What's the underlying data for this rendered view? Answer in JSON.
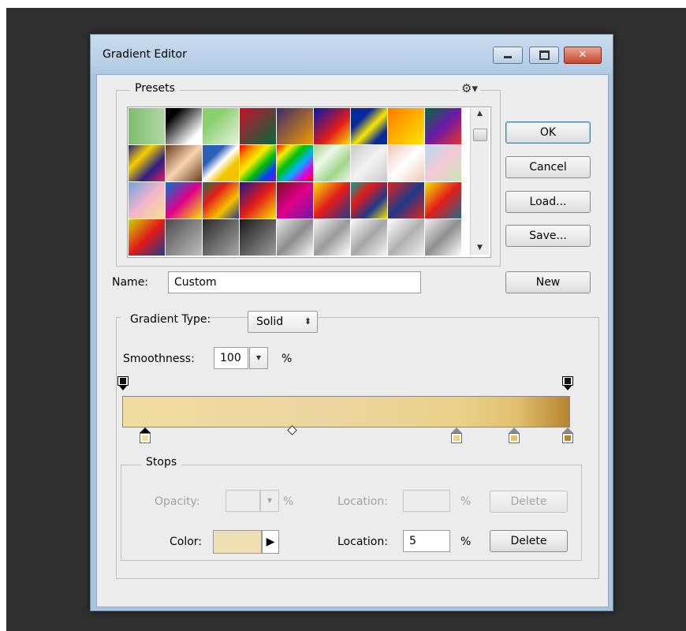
{
  "window": {
    "title": "Gradient Editor"
  },
  "presets": {
    "label": "Presets",
    "icon": "gear-icon",
    "swatches": [
      "linear-gradient(90deg,#7dbd6a,#b1d7a8)",
      "linear-gradient(135deg,#000 20%,#fff 80%)",
      "linear-gradient(135deg,#8bcf6f 30%,#e6f3e0 100%)",
      "linear-gradient(135deg,#c8102e,#006c3b)",
      "linear-gradient(135deg,#3b2a6e,#f59a00)",
      "linear-gradient(135deg,#0019a8,#e21b1b 60%,#f6e20a)",
      "linear-gradient(135deg,#0a2a9b 30%,#f8e600 55%,#0a2a9b 80%)",
      "linear-gradient(135deg,#ff7a00,#ffe600)",
      "linear-gradient(135deg,#006c3b,#6b1aa8,#e8332a)",
      "linear-gradient(135deg,#2c1f86,#f2d000,#2c1f86,#e51d5d)",
      "linear-gradient(135deg,#6b3b1f,#f8d4b0,#6b3b1f)",
      "linear-gradient(135deg,#2d5fb8 30%,#fff 50%,#f3c300 70%)",
      "linear-gradient(135deg,#ff0000,#ff8c00,#ffee00,#00c000,#0040ff,#a000c0)",
      "linear-gradient(135deg,#ff0000,#ffee00,#00c000,#00b0ff,#e000e0,#ff0000)",
      "linear-gradient(135deg,#a0d48a,#eef7e8,#a0d48a,#eef7e8)",
      "linear-gradient(135deg,#c8c8c8,#f2f2f2,#c8c8c8)",
      "linear-gradient(135deg,#f0c7b8,#fff,#f0c7b8)",
      "linear-gradient(135deg,#b9d8f0,#f2c9d6,#c7e6b0)",
      "linear-gradient(135deg,#6aa4e0,#f3b5c8,#f8e08e)",
      "linear-gradient(135deg,#0077c8,#e0008a,#f6e400)",
      "linear-gradient(135deg,#1f7a3a,#e21b1b,#f4c000,#1f3a8a)",
      "linear-gradient(135deg,#1a1a8c,#e21b1b,#f6e400)",
      "linear-gradient(135deg,#7a0f1f,#e0008a,#6b1aa8)",
      "linear-gradient(135deg,#f6e400,#e21b1b,#1f3a8a)",
      "linear-gradient(135deg,#00a896,#e21b1b,#1f3a8a,#f6e400)",
      "linear-gradient(135deg,#e2231a,#1f3a8a,#e2231a)",
      "linear-gradient(135deg,#f6e400,#e21b1b,#1f6a8a)",
      "linear-gradient(135deg,#c8d800,#e21b1b,#1f3a8a)",
      "linear-gradient(135deg,#4d4d4d,#bdbdbd)",
      "linear-gradient(135deg,#2a2a2a,#a8a8a8)",
      "linear-gradient(135deg,#1a1a1a,#9c9c9c)",
      "linear-gradient(135deg,#e6e6e6,#8c8c8c,#f7f7f7)",
      "linear-gradient(135deg,#f2f2f2,#9a9a9a,#ffffff)",
      "linear-gradient(135deg,#fafafa,#a6a6a6,#f5f5f5)",
      "linear-gradient(135deg,#ffffff,#b0b0b0,#eeeeee)",
      "linear-gradient(135deg,#f0f0f0,#8e8e8e,#fdfdfd)"
    ]
  },
  "buttons": {
    "ok": "OK",
    "cancel": "Cancel",
    "load": "Load...",
    "save": "Save...",
    "new": "New",
    "delete_opacity": "Delete",
    "delete_color": "Delete"
  },
  "name_field": {
    "label": "Name:",
    "value": "Custom"
  },
  "gradient_type": {
    "label": "Gradient Type:",
    "value": "Solid"
  },
  "smoothness": {
    "label": "Smoothness:",
    "value": "100",
    "unit": "%"
  },
  "gradient": {
    "opacity_stops": [
      0,
      100
    ],
    "color_stops": [
      {
        "location": 5,
        "color": "#f0dba0",
        "selected": true
      },
      {
        "location": 75,
        "color": "#ead28a",
        "selected": false
      },
      {
        "location": 88,
        "color": "#e2c070",
        "selected": false
      },
      {
        "location": 100,
        "color": "#b8832e",
        "selected": false
      }
    ],
    "midpoint": 38
  },
  "stops": {
    "label": "Stops",
    "opacity_label": "Opacity:",
    "opacity_value": "",
    "opacity_unit": "%",
    "opacity_location_label": "Location:",
    "opacity_location_value": "",
    "opacity_location_unit": "%",
    "color_label": "Color:",
    "color_value": "#efdfb2",
    "color_location_label": "Location:",
    "color_location_value": "5",
    "color_location_unit": "%"
  }
}
